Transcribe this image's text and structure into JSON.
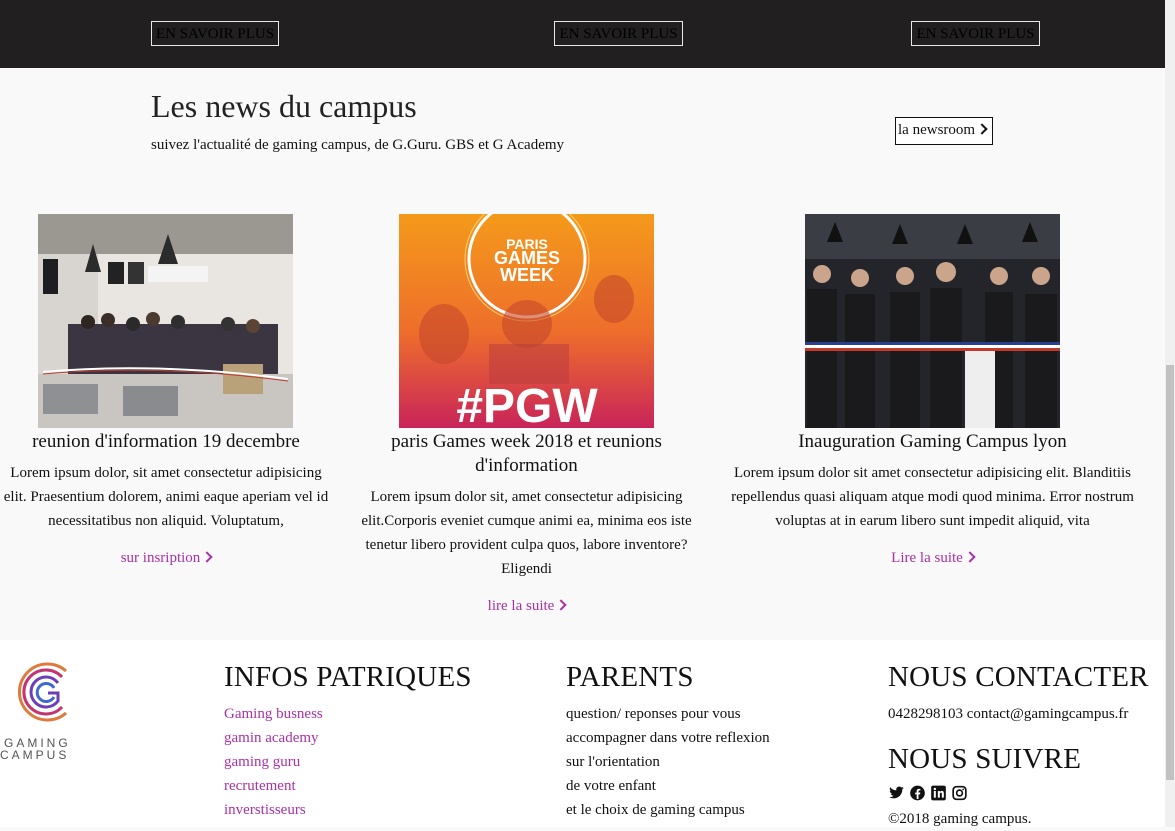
{
  "top": {
    "buttons": [
      "EN SAVOIR PLUS",
      "EN SAVOIR PLUS",
      "EN SAVOIR PLUS"
    ]
  },
  "news": {
    "title": "Les news du campus",
    "subtitle": "suivez l'actualité de gaming campus, de G.Guru. GBS et G Academy",
    "newsroom_label": "la newsroom"
  },
  "cards": [
    {
      "title": "reunion d'information 19 decembre",
      "text": "Lorem ipsum dolor, sit amet consectetur adipisicing elit. Praesentium dolorem, animi eaque aperiam vel id necessitatibus non aliquid. Voluptatum,",
      "link": "sur insription"
    },
    {
      "title": "paris Games week 2018 et reunions d'information",
      "text": "Lorem ipsum dolor sit, amet consectetur adipisicing elit.Corporis eveniet cumque animi ea, minima eos iste tenetur libero provident culpa quos, labore inventore? Eligendi",
      "link": "lire la suite",
      "image_text_top": "PARIS GAMES WEEK",
      "image_text_bottom": "#PGW"
    },
    {
      "title": "Inauguration Gaming Campus lyon",
      "text": "Lorem ipsum dolor sit amet consectetur adipisicing elit. Blanditiis repellendus quasi aliquam atque modi quod minima. Error nostrum voluptas at in earum libero sunt impedit aliquid, vita",
      "link": "Lire la suite"
    }
  ],
  "footer": {
    "logo_line1": "GAMING",
    "logo_line2": "CAMPUS",
    "infos": {
      "heading": "INFOS PATRIQUES",
      "items": [
        "Gaming busness",
        "gamin academy",
        "gaming guru",
        "recrutement",
        "inverstisseurs"
      ]
    },
    "parents": {
      "heading": "PARENTS",
      "items": [
        "question/ reponses pour vous",
        "accompagner dans votre reflexion",
        "sur l'orientation",
        "de votre enfant",
        "et le choix de gaming campus"
      ]
    },
    "contact": {
      "heading": "NOUS CONTACTER",
      "text": "0428298103 contact@gamingcampus.fr"
    },
    "follow": {
      "heading": "NOUS SUIVRE",
      "icons": [
        "twitter-icon",
        "facebook-icon",
        "linkedin-icon",
        "instagram-icon"
      ],
      "copyright_symbol": "©",
      "copyright": "2018 gaming campus."
    }
  },
  "colors": {
    "accent": "#a931a7",
    "dark_band": "#211f20",
    "background": "#f9f9f9"
  }
}
